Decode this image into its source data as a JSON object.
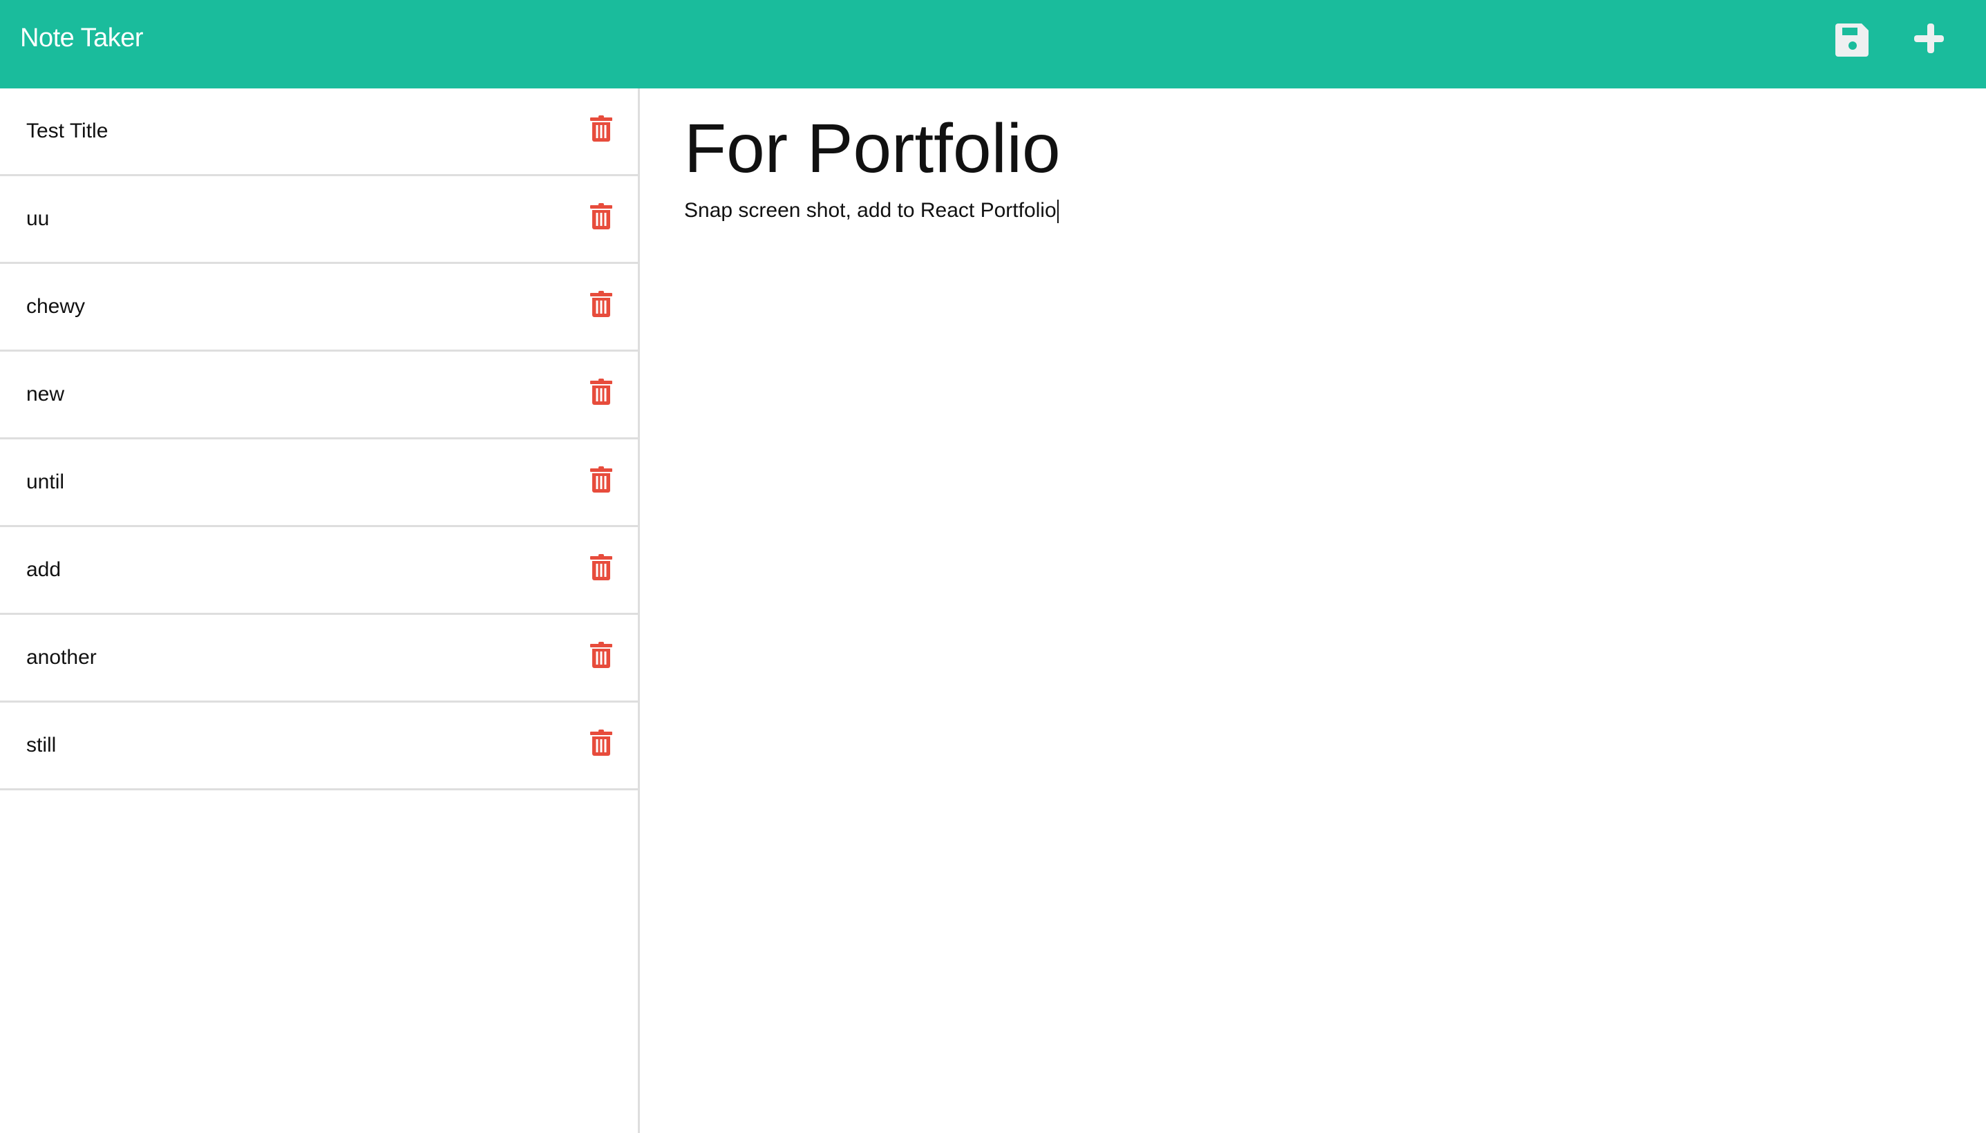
{
  "header": {
    "title": "Note Taker",
    "save_icon": "save-icon",
    "add_icon": "plus-icon",
    "bg_color": "#1abc9c"
  },
  "notes": [
    {
      "title": "Test Title"
    },
    {
      "title": "uu"
    },
    {
      "title": "chewy"
    },
    {
      "title": "new"
    },
    {
      "title": "until"
    },
    {
      "title": "add"
    },
    {
      "title": "another"
    },
    {
      "title": "still"
    }
  ],
  "active_note": {
    "title": "For Portfolio",
    "text": "Snap screen shot, add to React Portfolio"
  },
  "colors": {
    "delete": "#e74c3c"
  }
}
